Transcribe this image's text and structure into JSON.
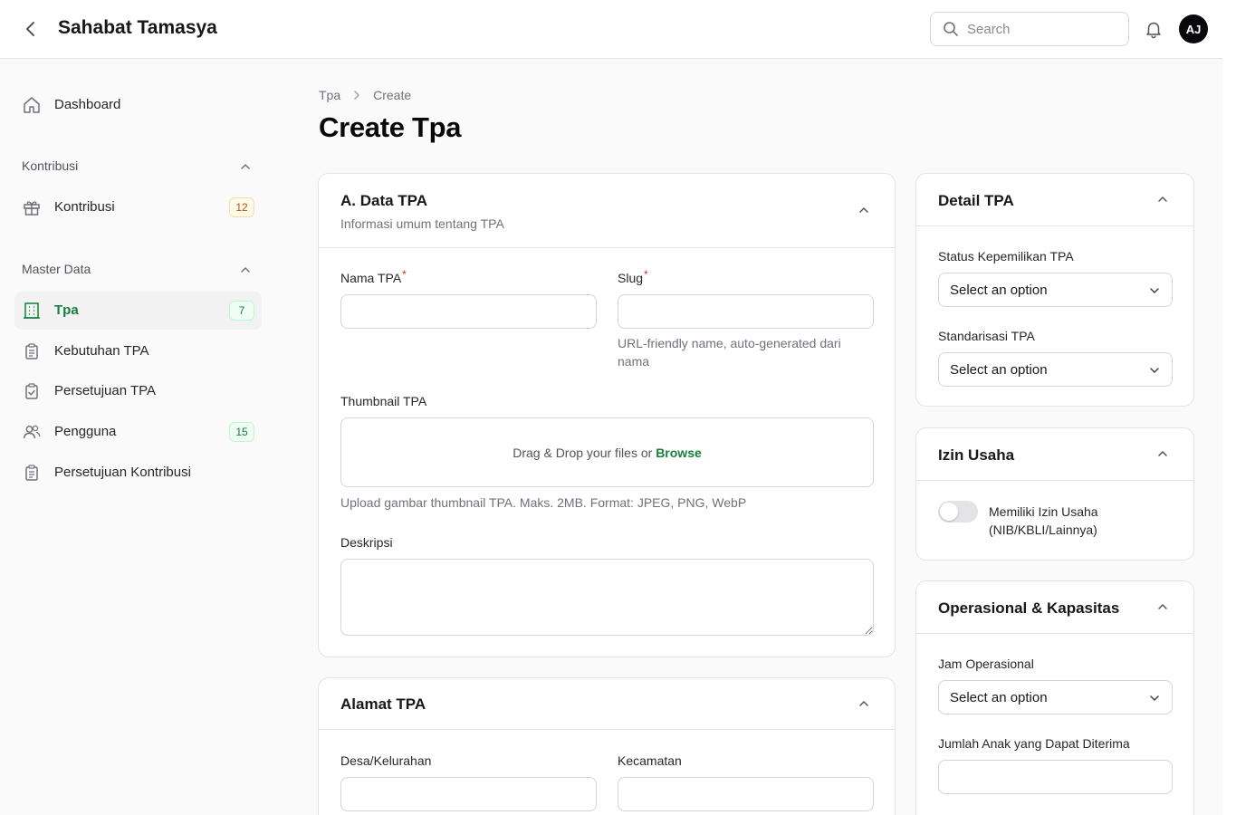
{
  "app": {
    "title": "Sahabat Tamasya",
    "avatar_initials": "AJ"
  },
  "search": {
    "placeholder": "Search",
    "value": ""
  },
  "sidebar": {
    "dashboard": {
      "label": "Dashboard"
    },
    "groups": [
      {
        "label": "Kontribusi",
        "items": [
          {
            "label": "Kontribusi",
            "badge": "12"
          }
        ]
      },
      {
        "label": "Master Data",
        "items": [
          {
            "label": "Tpa",
            "badge": "7",
            "active": true
          },
          {
            "label": "Kebutuhan TPA"
          },
          {
            "label": "Persetujuan TPA"
          },
          {
            "label": "Pengguna",
            "badge": "15"
          },
          {
            "label": "Persetujuan Kontribusi"
          }
        ]
      }
    ]
  },
  "breadcrumb": {
    "items": [
      "Tpa",
      "Create"
    ]
  },
  "page": {
    "title": "Create Tpa"
  },
  "sections": {
    "data_tpa": {
      "title": "A. Data TPA",
      "subtitle": "Informasi umum tentang TPA",
      "nama_label": "Nama TPA",
      "slug_label": "Slug",
      "required_mark": "*",
      "slug_help": "URL-friendly name, auto-generated dari nama",
      "thumbnail_label": "Thumbnail TPA",
      "dropzone_text": "Drag & Drop your files or",
      "dropzone_link": "Browse",
      "thumbnail_help": "Upload gambar thumbnail TPA. Maks. 2MB. Format: JPEG, PNG, WebP",
      "deskripsi_label": "Deskripsi"
    },
    "alamat": {
      "title": "Alamat TPA",
      "desa_label": "Desa/Kelurahan",
      "kecamatan_label": "Kecamatan"
    },
    "detail": {
      "title": "Detail TPA",
      "status_label": "Status Kepemilikan TPA",
      "status_value": "Select an option",
      "standar_label": "Standarisasi TPA",
      "standar_value": "Select an option"
    },
    "izin": {
      "title": "Izin Usaha",
      "toggle_label": "Memiliki Izin Usaha (NIB/KBLI/Lainnya)",
      "toggle_on": false
    },
    "operasional": {
      "title": "Operasional & Kapasitas",
      "jam_label": "Jam Operasional",
      "jam_value": "Select an option",
      "jumlah_label": "Jumlah Anak yang Dapat Diterima"
    }
  },
  "colors": {
    "accent": "#15803d",
    "required": "#dc2626",
    "badge_warn": "#b45309"
  }
}
